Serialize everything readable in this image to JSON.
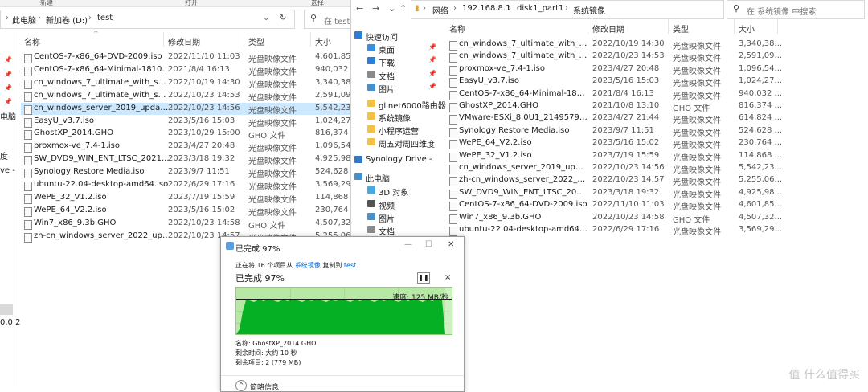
{
  "left": {
    "toolbar": [
      "新建",
      "打开",
      "选择"
    ],
    "breadcrumbs": [
      "此电脑",
      "新加卷 (D:)",
      "test"
    ],
    "search_placeholder": "在 test",
    "columns": {
      "name": "名称",
      "date": "修改日期",
      "type": "类型",
      "size": "大小"
    },
    "side_labels": [
      "电脑",
      "度",
      "ve -",
      "0.0.2"
    ],
    "files": [
      {
        "name": "CentOS-7-x86_64-DVD-2009.iso",
        "date": "2022/11/10 11:03",
        "type": "光盘映像文件",
        "size": "4,601,85..."
      },
      {
        "name": "CentOS-7-x86_64-Minimal-1810....",
        "date": "2021/8/4 16:13",
        "type": "光盘映像文件",
        "size": "940,032 ..."
      },
      {
        "name": "cn_windows_7_ultimate_with_sp1...",
        "date": "2022/10/19 14:30",
        "type": "光盘映像文件",
        "size": "3,340,38..."
      },
      {
        "name": "cn_windows_7_ultimate_with_sp1...",
        "date": "2022/10/23 14:53",
        "type": "光盘映像文件",
        "size": "2,591,09..."
      },
      {
        "name": "cn_windows_server_2019_update...",
        "date": "2022/10/23 14:56",
        "type": "光盘映像文件",
        "size": "5,542,23..."
      },
      {
        "name": "EasyU_v3.7.iso",
        "date": "2023/5/16 15:03",
        "type": "光盘映像文件",
        "size": "1,024,27..."
      },
      {
        "name": "GhostXP_2014.GHO",
        "date": "2023/10/29 15:00",
        "type": "GHO 文件",
        "size": "816,374 ..."
      },
      {
        "name": "proxmox-ve_7.4-1.iso",
        "date": "2023/4/27 20:48",
        "type": "光盘映像文件",
        "size": "1,096,54..."
      },
      {
        "name": "SW_DVD9_WIN_ENT_LTSC_2021...",
        "date": "2023/3/18 19:32",
        "type": "光盘映像文件",
        "size": "4,925,98..."
      },
      {
        "name": "Synology Restore Media.iso",
        "date": "2023/9/7 11:51",
        "type": "光盘映像文件",
        "size": "524,628 ..."
      },
      {
        "name": "ubuntu-22.04-desktop-amd64.iso",
        "date": "2022/6/29 17:16",
        "type": "光盘映像文件",
        "size": "3,569,29..."
      },
      {
        "name": "WePE_32_V1.2.iso",
        "date": "2023/7/19 15:59",
        "type": "光盘映像文件",
        "size": "114,868 ..."
      },
      {
        "name": "WePE_64_V2.2.iso",
        "date": "2023/5/16 15:02",
        "type": "光盘映像文件",
        "size": "230,764 ..."
      },
      {
        "name": "Win7_x86_9.3b.GHO",
        "date": "2022/10/23 14:58",
        "type": "GHO 文件",
        "size": "4,507,32..."
      },
      {
        "name": "zh-cn_windows_server_2022_upd...",
        "date": "2022/10/23 14:57",
        "type": "光盘映像文件",
        "size": "5,255,06..."
      }
    ]
  },
  "right": {
    "breadcrumbs": [
      "网络",
      "192.168.8.1",
      "disk1_part1",
      "系统镜像"
    ],
    "search_placeholder": "在 系统镜像 中搜索",
    "columns": {
      "name": "名称",
      "date": "修改日期",
      "type": "类型",
      "size": "大小"
    },
    "nav": [
      {
        "label": "快速访问",
        "color": "#2d7fd6"
      },
      {
        "label": "桌面",
        "color": "#3b8ede"
      },
      {
        "label": "下载",
        "color": "#2d7fd6"
      },
      {
        "label": "文档",
        "color": "#8a8a8a"
      },
      {
        "label": "图片",
        "color": "#4a90c8"
      },
      {
        "label": "glinet6000路由器",
        "color": "#f0c24a"
      },
      {
        "label": "系统镜像",
        "color": "#f0c24a"
      },
      {
        "label": "小程序运营",
        "color": "#f0c24a"
      },
      {
        "label": "周五对周四维度",
        "color": "#f0c24a"
      },
      {
        "label": "Synology Drive -",
        "color": "#3477c4"
      },
      {
        "label": "此电脑",
        "color": "#4a90c8"
      },
      {
        "label": "3D 对象",
        "color": "#4aa8e0"
      },
      {
        "label": "视频",
        "color": "#555555"
      },
      {
        "label": "图片",
        "color": "#4a90c8"
      },
      {
        "label": "文档",
        "color": "#8a8a8a"
      }
    ],
    "files": [
      {
        "name": "cn_windows_7_ultimate_with_sp1...",
        "date": "2022/10/19 14:30",
        "type": "光盘映像文件",
        "size": "3,340,38..."
      },
      {
        "name": "cn_windows_7_ultimate_with_sp1...",
        "date": "2022/10/23 14:53",
        "type": "光盘映像文件",
        "size": "2,591,09..."
      },
      {
        "name": "proxmox-ve_7.4-1.iso",
        "date": "2023/4/27 20:48",
        "type": "光盘映像文件",
        "size": "1,096,54..."
      },
      {
        "name": "EasyU_v3.7.iso",
        "date": "2023/5/16 15:03",
        "type": "光盘映像文件",
        "size": "1,024,27..."
      },
      {
        "name": "CentOS-7-x86_64-Minimal-1810....",
        "date": "2021/8/4 16:13",
        "type": "光盘映像文件",
        "size": "940,032 ..."
      },
      {
        "name": "GhostXP_2014.GHO",
        "date": "2021/10/8 13:10",
        "type": "GHO 文件",
        "size": "816,374 ..."
      },
      {
        "name": "VMware-ESXi_8.0U1_21495797_...",
        "date": "2023/4/27 21:44",
        "type": "光盘映像文件",
        "size": "614,824 ..."
      },
      {
        "name": "Synology Restore Media.iso",
        "date": "2023/9/7 11:51",
        "type": "光盘映像文件",
        "size": "524,628 ..."
      },
      {
        "name": "WePE_64_V2.2.iso",
        "date": "2023/5/16 15:02",
        "type": "光盘映像文件",
        "size": "230,764 ..."
      },
      {
        "name": "WePE_32_V1.2.iso",
        "date": "2023/7/19 15:59",
        "type": "光盘映像文件",
        "size": "114,868 ..."
      },
      {
        "name": "cn_windows_server_2019_update...",
        "date": "2022/10/23 14:56",
        "type": "光盘映像文件",
        "size": "5,542,23..."
      },
      {
        "name": "zh-cn_windows_server_2022_upd...",
        "date": "2022/10/23 14:57",
        "type": "光盘映像文件",
        "size": "5,255,06..."
      },
      {
        "name": "SW_DVD9_WIN_ENT_LTSC_2021...",
        "date": "2023/3/18 19:32",
        "type": "光盘映像文件",
        "size": "4,925,98..."
      },
      {
        "name": "CentOS-7-x86_64-DVD-2009.iso",
        "date": "2022/11/10 11:03",
        "type": "光盘映像文件",
        "size": "4,601,85..."
      },
      {
        "name": "Win7_x86_9.3b.GHO",
        "date": "2022/10/23 14:58",
        "type": "GHO 文件",
        "size": "4,507,32..."
      },
      {
        "name": "ubuntu-22.04-desktop-amd64.iso",
        "date": "2022/6/29 17:16",
        "type": "光盘映像文件",
        "size": "3,569,29..."
      }
    ]
  },
  "dialog": {
    "title": "已完成 97%",
    "copy_line": {
      "prefix": "正在将 16 个项目从",
      "source": "系统镜像",
      "middle": "复制到",
      "dest": "test"
    },
    "progress_label": "已完成 97%",
    "progress": 0.97,
    "speed": "速度: 125 MB/秒",
    "name_line": "名称: GhostXP_2014.GHO",
    "time_line": "剩余时间: 大约 10 秒",
    "items_line": "剩余项目: 2 (779 MB)",
    "details": "简略信息",
    "pause_icon": "pause-icon",
    "close_icon": "close-icon"
  },
  "watermark": "值 什么值得买",
  "colors": {
    "selected": "#cce8ff",
    "graph_bg": "#b7e8a6",
    "graph_fill": "#06b025",
    "link": "#0066cc"
  }
}
